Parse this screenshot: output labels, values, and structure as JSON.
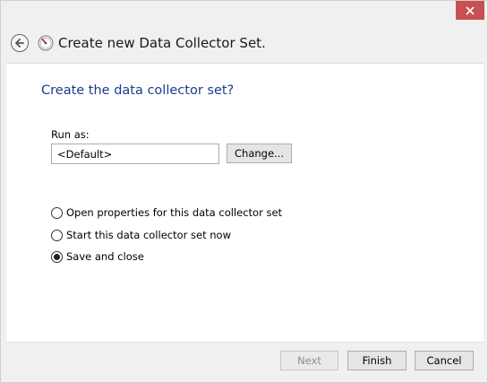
{
  "wizard": {
    "title": "Create new Data Collector Set."
  },
  "page": {
    "heading": "Create the data collector set?",
    "run_as_label": "Run as:",
    "run_as_value": "<Default>",
    "change_button": "Change..."
  },
  "options": [
    {
      "label": "Open properties for this data collector set",
      "selected": false
    },
    {
      "label": "Start this data collector set now",
      "selected": false
    },
    {
      "label": "Save and close",
      "selected": true
    }
  ],
  "footer": {
    "next_label": "Next",
    "finish_label": "Finish",
    "cancel_label": "Cancel"
  },
  "icons": {
    "close": "close-icon",
    "back": "back-arrow-icon",
    "app": "performance-monitor-icon"
  },
  "colors": {
    "heading": "#1e3c8c",
    "close_button": "#c75050"
  }
}
